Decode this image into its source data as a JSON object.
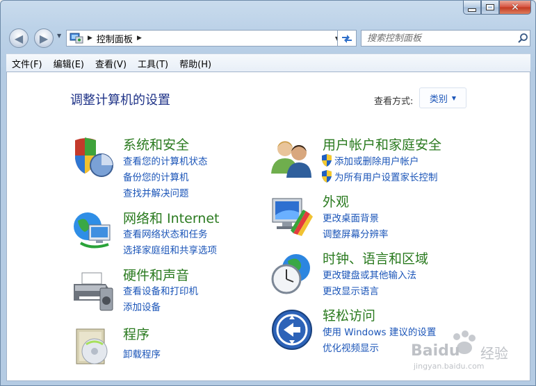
{
  "window": {
    "caption_buttons": {
      "minimize": "minimize-icon",
      "maximize": "maximize-icon",
      "close": "close-icon"
    }
  },
  "nav": {
    "breadcrumb": "控制面板",
    "search_placeholder": "搜索控制面板"
  },
  "menu": [
    "文件(F)",
    "编辑(E)",
    "查看(V)",
    "工具(T)",
    "帮助(H)"
  ],
  "content": {
    "title": "调整计算机的设置",
    "view_by_label": "查看方式:",
    "view_by_value": "类别"
  },
  "categories": [
    {
      "id": "system-security",
      "title": "系统和安全",
      "icon": "shield-pie-icon",
      "links": [
        {
          "text": "查看您的计算机状态"
        },
        {
          "text": "备份您的计算机"
        },
        {
          "text": "查找并解决问题"
        }
      ]
    },
    {
      "id": "network-internet",
      "title": "网络和 Internet",
      "icon": "network-globe-icon",
      "links": [
        {
          "text": "查看网络状态和任务"
        },
        {
          "text": "选择家庭组和共享选项"
        }
      ]
    },
    {
      "id": "hardware-sound",
      "title": "硬件和声音",
      "icon": "printer-speaker-icon",
      "links": [
        {
          "text": "查看设备和打印机"
        },
        {
          "text": "添加设备"
        }
      ]
    },
    {
      "id": "programs",
      "title": "程序",
      "icon": "programs-disc-icon",
      "links": [
        {
          "text": "卸载程序"
        }
      ]
    },
    {
      "id": "user-accounts",
      "title": "用户帐户和家庭安全",
      "icon": "users-icon",
      "links": [
        {
          "text": "添加或删除用户帐户",
          "shield": true
        },
        {
          "text": "为所有用户设置家长控制",
          "shield": true
        }
      ]
    },
    {
      "id": "appearance",
      "title": "外观",
      "icon": "monitor-palette-icon",
      "links": [
        {
          "text": "更改桌面背景"
        },
        {
          "text": "调整屏幕分辨率"
        }
      ]
    },
    {
      "id": "clock-language-region",
      "title": "时钟、语言和区域",
      "icon": "clock-globe-icon",
      "links": [
        {
          "text": "更改键盘或其他输入法"
        },
        {
          "text": "更改显示语言"
        }
      ]
    },
    {
      "id": "ease-of-access",
      "title": "轻松访问",
      "icon": "ease-of-access-icon",
      "links": [
        {
          "text": "使用 Windows 建议的设置"
        },
        {
          "text": "优化视频显示"
        }
      ]
    }
  ],
  "watermark": {
    "brand": "Baidu",
    "brand_cn": "经验",
    "url": "jingyan.baidu.com"
  },
  "colors": {
    "title_green": "#2a7a1f",
    "link_blue": "#1b55b8",
    "heading_blue": "#1e3287"
  }
}
